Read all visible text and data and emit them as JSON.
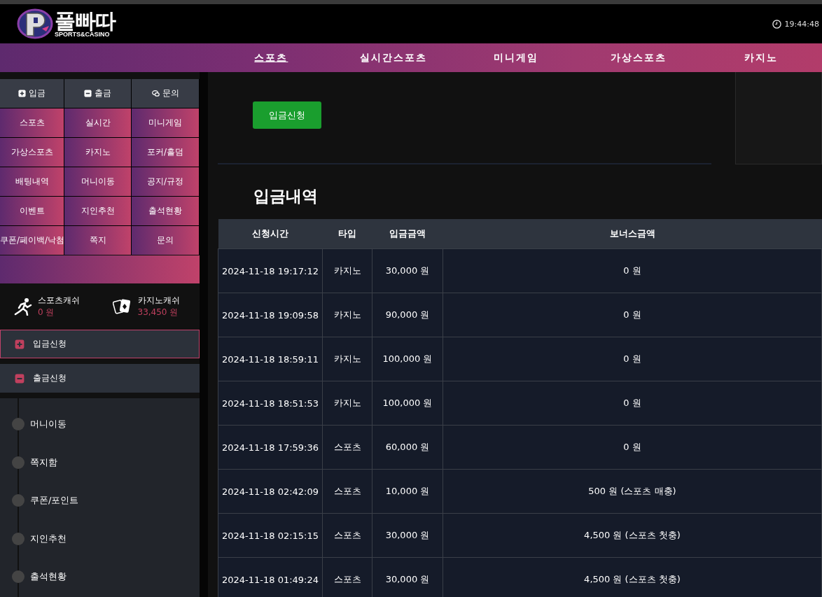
{
  "header": {
    "logo_text": "풀빠따",
    "logo_sub": "SPORTS&CASINO",
    "clock": "19:44:48"
  },
  "nav": [
    "스포츠",
    "실시간스포츠",
    "미니게임",
    "가상스포츠",
    "카지노"
  ],
  "quick": [
    {
      "kind": "plus",
      "label": "입금"
    },
    {
      "kind": "minus",
      "label": "출금"
    },
    {
      "kind": "chat",
      "label": "문의"
    }
  ],
  "menu_grid": [
    "스포츠",
    "실시간",
    "미니게임",
    "가상스포츠",
    "카지노",
    "포커/홀덤",
    "배팅내역",
    "머니이동",
    "공지/규정",
    "이벤트",
    "지인추천",
    "출석현황",
    "쿠폰/페이백/낙첨",
    "쪽지",
    "문의"
  ],
  "cash": [
    {
      "kind": "sports",
      "label": "스포츠캐쉬",
      "amount": "0 원"
    },
    {
      "kind": "casino",
      "label": "카지노캐쉬",
      "amount": "33,450 원"
    }
  ],
  "actions": [
    {
      "kind": "plus",
      "label": "입금신청",
      "selected": true
    },
    {
      "kind": "minus",
      "label": "출금신청",
      "selected": false
    }
  ],
  "submenu": [
    "머니이동",
    "쪽지함",
    "쿠폰/포인트",
    "지인추천",
    "출석현황"
  ],
  "main": {
    "button": "입금신청",
    "title": "입금내역"
  },
  "table": {
    "columns": [
      "신청시간",
      "타입",
      "입금금액",
      "보너스금액"
    ],
    "rows": [
      [
        "2024-11-18 19:17:12",
        "카지노",
        "30,000 원",
        "0 원"
      ],
      [
        "2024-11-18 19:09:58",
        "카지노",
        "90,000 원",
        "0 원"
      ],
      [
        "2024-11-18 18:59:11",
        "카지노",
        "100,000 원",
        "0 원"
      ],
      [
        "2024-11-18 18:51:53",
        "카지노",
        "100,000 원",
        "0 원"
      ],
      [
        "2024-11-18 17:59:36",
        "스포츠",
        "60,000 원",
        "0 원"
      ],
      [
        "2024-11-18 02:42:09",
        "스포츠",
        "10,000 원",
        "500 원 (스포츠 매충)"
      ],
      [
        "2024-11-18 02:15:15",
        "스포츠",
        "30,000 원",
        "4,500 원 (스포츠 첫충)"
      ],
      [
        "2024-11-18 01:49:24",
        "스포츠",
        "30,000 원",
        "4,500 원 (스포츠 첫충)"
      ]
    ]
  }
}
